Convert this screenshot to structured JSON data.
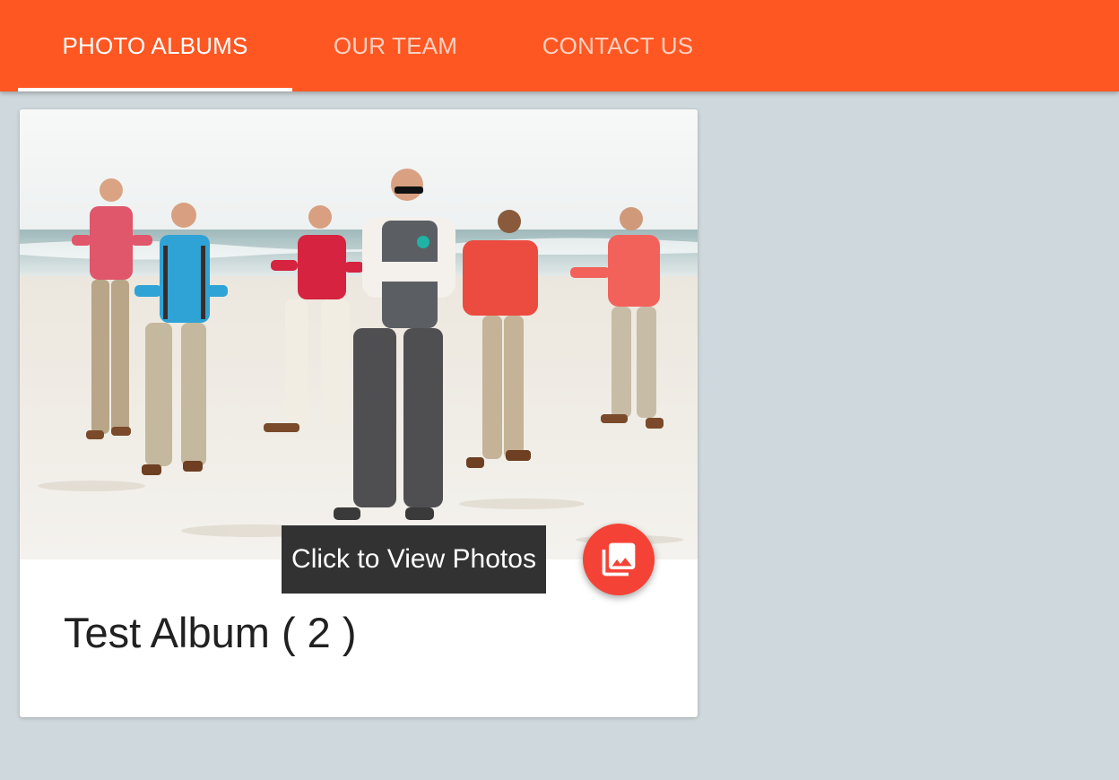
{
  "nav": {
    "tabs": [
      {
        "label": "PHOTO ALBUMS",
        "active": true
      },
      {
        "label": "OUR TEAM",
        "active": false
      },
      {
        "label": "CONTACT US",
        "active": false
      }
    ]
  },
  "album_card": {
    "title": "Test Album ( 2 )",
    "image_icon": "beach-group-photo",
    "fab_icon": "photo-library-icon",
    "tooltip": "Click to View Photos"
  },
  "colors": {
    "appbar": "#ff5722",
    "background": "#cfd8dc",
    "fab": "#f44336",
    "tooltip": "#323232"
  }
}
